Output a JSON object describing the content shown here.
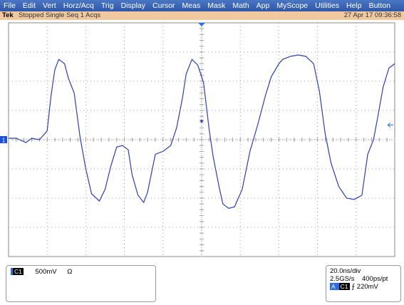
{
  "menu": [
    "File",
    "Edit",
    "Vert",
    "Horz/Acq",
    "Trig",
    "Display",
    "Cursor",
    "Meas",
    "Mask",
    "Math",
    "App",
    "MyScope",
    "Utilities",
    "Help",
    "Button"
  ],
  "status": {
    "brand": "Tek",
    "state": "Stopped Single Seq 1 Acqs",
    "datetime": "27 Apr 17 09:36:58"
  },
  "graticule": {
    "divisions_x": 10,
    "divisions_y": 8
  },
  "markers": {
    "channel_ground_label": "1"
  },
  "channel": {
    "tag": "C1",
    "scale": "500mV",
    "impedance": "Ω"
  },
  "timebase": {
    "time_per_div": "20.0ns/div",
    "sample_rate": "2.5GS/s",
    "resolution": "400ps/pt",
    "trigger_source_A": "A",
    "trigger_source": "C1",
    "trigger_slope": "⨍",
    "trigger_level": "220mV"
  },
  "colors": {
    "trace": "#2f3fb0",
    "ground_marker": "#1a4fd8",
    "graticule": "#a0a0a0",
    "menubar": "#3a63b8"
  },
  "chart_data": {
    "type": "line",
    "title": "",
    "xlabel": "",
    "ylabel": "",
    "x_units": "divisions (20.0ns/div)",
    "y_units": "divisions (500mV/div)",
    "xlim": [
      0,
      10
    ],
    "ylim": [
      -4,
      4
    ],
    "series": [
      {
        "name": "",
        "x": [
          0,
          0.2,
          0.45,
          0.6,
          0.8,
          1.0,
          1.1,
          1.2,
          1.3,
          1.45,
          1.55,
          1.7,
          1.85,
          2.0,
          2.15,
          2.35,
          2.5,
          2.65,
          2.8,
          2.95,
          3.1,
          3.2,
          3.35,
          3.5,
          3.6,
          3.8,
          4.0,
          4.2,
          4.35,
          4.5,
          4.6,
          4.75,
          4.9,
          5.05,
          5.2,
          5.3,
          5.45,
          5.55,
          5.7,
          5.85,
          6.05,
          6.25,
          6.45,
          6.65,
          6.8,
          7.0,
          7.1,
          7.3,
          7.5,
          7.7,
          7.9,
          8.05,
          8.2,
          8.35,
          8.55,
          8.75,
          8.95,
          9.15,
          9.3,
          9.45,
          9.55,
          9.7,
          9.85,
          10.0
        ],
        "y": [
          0.05,
          0.05,
          -0.1,
          0.05,
          0.0,
          0.3,
          1.5,
          2.4,
          2.75,
          2.6,
          2.1,
          1.6,
          0.1,
          -1.0,
          -1.85,
          -2.1,
          -1.7,
          -0.9,
          -0.25,
          -0.2,
          -0.35,
          -1.2,
          -1.9,
          -2.15,
          -1.8,
          -0.5,
          -0.4,
          -0.2,
          0.4,
          1.4,
          2.25,
          2.75,
          2.55,
          1.95,
          0.3,
          -0.6,
          -1.6,
          -2.2,
          -2.35,
          -2.3,
          -1.7,
          -0.4,
          0.5,
          1.5,
          2.15,
          2.6,
          2.75,
          2.85,
          2.9,
          2.85,
          2.6,
          1.65,
          0.2,
          -0.8,
          -1.6,
          -2.0,
          -2.05,
          -1.9,
          -0.5,
          0.0,
          0.7,
          1.8,
          2.45,
          2.6
        ]
      }
    ]
  }
}
